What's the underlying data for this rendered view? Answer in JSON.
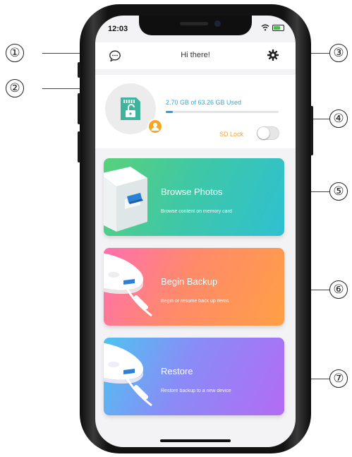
{
  "callouts": [
    "①",
    "②",
    "③",
    "④",
    "⑤",
    "⑥",
    "⑦"
  ],
  "status_bar": {
    "time": "12:03"
  },
  "header": {
    "title": "Hi there!"
  },
  "storage": {
    "used_text": "2.70 GB of 63.26 GB Used",
    "used_fraction": 0.0427
  },
  "sd_lock": {
    "label": "SD Lock",
    "enabled": false
  },
  "cards": [
    {
      "title": "Browse Photos",
      "subtitle": "Browse content on memory card"
    },
    {
      "title": "Begin Backup",
      "subtitle": "Begin or resume back up items"
    },
    {
      "title": "Restore",
      "subtitle": "Restore backup to a new device"
    }
  ],
  "colors": {
    "accent_blue": "#2d9be0",
    "sd_lock_orange": "#f3a43c",
    "browse_gradient": [
      "#59d07a",
      "#2ec0d2"
    ],
    "backup_gradient": [
      "#ff6fb0",
      "#ff9f45"
    ],
    "restore_gradient": [
      "#4ec3f0",
      "#b36bf4"
    ]
  }
}
